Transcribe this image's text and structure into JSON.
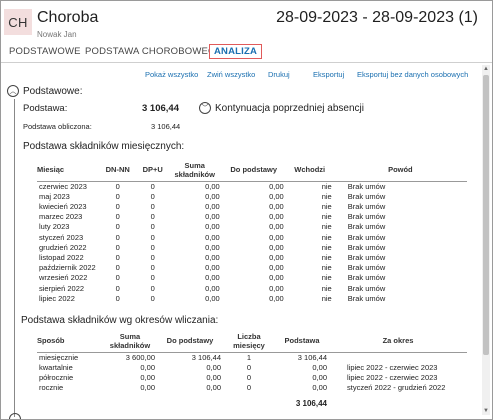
{
  "header": {
    "avatar_initials": "CH",
    "title": "Choroba",
    "subtitle": "Nowak Jan",
    "date_range": "28-09-2023 - 28-09-2023 (1)"
  },
  "tabs": [
    {
      "label": "PODSTAWOWE",
      "active": false
    },
    {
      "label": "PODSTAWA CHOROBOWEGO",
      "active": false
    },
    {
      "label": "ANALIZA",
      "active": true
    }
  ],
  "actions": {
    "show_all": "Pokaż wszystko",
    "collapse_all": "Zwiń wszystko",
    "print": "Drukuj",
    "export": "Eksportuj",
    "export_no_personal": "Eksportuj bez danych osobowych"
  },
  "basic": {
    "section_label": "Podstawowe:",
    "base_label": "Podstawa:",
    "base_value": "3 106,44",
    "continuation_label": "Kontynuacja poprzedniej absencji",
    "calculated_label": "Podstawa obliczona:",
    "calculated_value": "3 106,44"
  },
  "monthly": {
    "title": "Podstawa składników miesięcznych:",
    "headers": {
      "month": "Miesiąc",
      "dn_nn": "DN-NN",
      "dp_u": "DP+U",
      "sum": "Suma składników",
      "base": "Do podstawy",
      "included": "Wchodzi",
      "reason": "Powód"
    },
    "rows": [
      {
        "month": "czerwiec 2023",
        "dn": "0",
        "dp": "0",
        "sum": "0,00",
        "base": "0,00",
        "inc": "nie",
        "reason": "Brak umów"
      },
      {
        "month": "maj 2023",
        "dn": "0",
        "dp": "0",
        "sum": "0,00",
        "base": "0,00",
        "inc": "nie",
        "reason": "Brak umów"
      },
      {
        "month": "kwiecień 2023",
        "dn": "0",
        "dp": "0",
        "sum": "0,00",
        "base": "0,00",
        "inc": "nie",
        "reason": "Brak umów"
      },
      {
        "month": "marzec 2023",
        "dn": "0",
        "dp": "0",
        "sum": "0,00",
        "base": "0,00",
        "inc": "nie",
        "reason": "Brak umów"
      },
      {
        "month": "luty 2023",
        "dn": "0",
        "dp": "0",
        "sum": "0,00",
        "base": "0,00",
        "inc": "nie",
        "reason": "Brak umów"
      },
      {
        "month": "styczeń 2023",
        "dn": "0",
        "dp": "0",
        "sum": "0,00",
        "base": "0,00",
        "inc": "nie",
        "reason": "Brak umów"
      },
      {
        "month": "grudzień 2022",
        "dn": "0",
        "dp": "0",
        "sum": "0,00",
        "base": "0,00",
        "inc": "nie",
        "reason": "Brak umów"
      },
      {
        "month": "listopad 2022",
        "dn": "0",
        "dp": "0",
        "sum": "0,00",
        "base": "0,00",
        "inc": "nie",
        "reason": "Brak umów"
      },
      {
        "month": "październik 2022",
        "dn": "0",
        "dp": "0",
        "sum": "0,00",
        "base": "0,00",
        "inc": "nie",
        "reason": "Brak umów"
      },
      {
        "month": "wrzesień 2022",
        "dn": "0",
        "dp": "0",
        "sum": "0,00",
        "base": "0,00",
        "inc": "nie",
        "reason": "Brak umów"
      },
      {
        "month": "sierpień 2022",
        "dn": "0",
        "dp": "0",
        "sum": "0,00",
        "base": "0,00",
        "inc": "nie",
        "reason": "Brak umów"
      },
      {
        "month": "lipiec 2022",
        "dn": "0",
        "dp": "0",
        "sum": "0,00",
        "base": "0,00",
        "inc": "nie",
        "reason": "Brak umów"
      }
    ]
  },
  "periods": {
    "title": "Podstawa składników wg okresów wliczania:",
    "headers": {
      "method": "Sposób",
      "sum": "Suma składników",
      "base": "Do podstawy",
      "count": "Liczba miesięcy",
      "basis": "Podstawa",
      "for_period": "Za okres"
    },
    "rows": [
      {
        "method": "miesięcznie",
        "sum": "3 600,00",
        "base": "3 106,44",
        "count": "1",
        "basis": "3 106,44",
        "period": ""
      },
      {
        "method": "kwartalnie",
        "sum": "0,00",
        "base": "0,00",
        "count": "0",
        "basis": "0,00",
        "period": "lipiec 2022 - czerwiec 2023"
      },
      {
        "method": "półrocznie",
        "sum": "0,00",
        "base": "0,00",
        "count": "0",
        "basis": "0,00",
        "period": "lipiec 2022 - czerwiec 2023"
      },
      {
        "method": "rocznie",
        "sum": "0,00",
        "base": "0,00",
        "count": "0",
        "basis": "0,00",
        "period": "styczeń 2022 - grudzień 2022"
      }
    ],
    "total": "3 106,44"
  },
  "colors": {
    "accent": "#1a6fb0",
    "active_tab_border": "#e05a5a",
    "avatar_bg": "#f3dede"
  }
}
